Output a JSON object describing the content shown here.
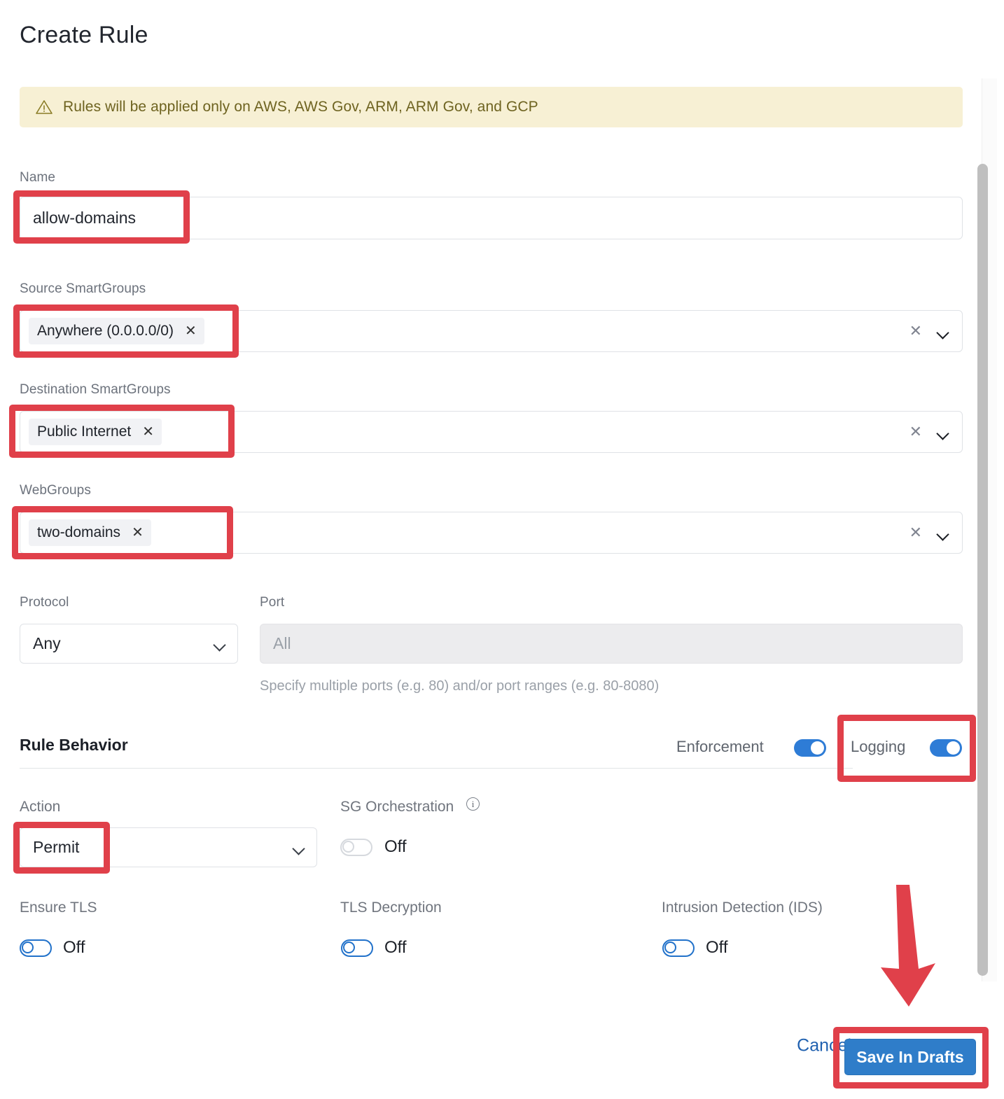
{
  "page": {
    "title": "Create Rule"
  },
  "banner": {
    "icon": "warning-triangle-icon",
    "text": "Rules will be applied only on AWS, AWS Gov, ARM, ARM Gov, and GCP"
  },
  "form": {
    "name": {
      "label": "Name",
      "value": "allow-domains",
      "placeholder": ""
    },
    "source_smartgroups": {
      "label": "Source SmartGroups",
      "chips": [
        "Anywhere (0.0.0.0/0)"
      ],
      "chip_remove": "✕",
      "clear": "✕"
    },
    "destination_smartgroups": {
      "label": "Destination SmartGroups",
      "chips": [
        "Public Internet"
      ],
      "chip_remove": "✕",
      "clear": "✕"
    },
    "webgroups": {
      "label": "WebGroups",
      "chips": [
        "two-domains"
      ],
      "chip_remove": "✕",
      "clear": "✕"
    },
    "protocol": {
      "label": "Protocol",
      "value": "Any"
    },
    "port": {
      "label": "Port",
      "placeholder": "All",
      "value": "",
      "helper": "Specify multiple ports (e.g. 80) and/or port ranges (e.g. 80-8080)"
    }
  },
  "rule_behavior": {
    "title": "Rule Behavior",
    "enforcement": {
      "label": "Enforcement",
      "state": "on"
    },
    "logging": {
      "label": "Logging",
      "state": "on"
    },
    "action": {
      "label": "Action",
      "value": "Permit"
    },
    "sg_orchestration": {
      "label": "SG Orchestration",
      "info_icon": "info-icon",
      "info_glyph": "i",
      "state_text": "Off"
    },
    "ensure_tls": {
      "label": "Ensure TLS",
      "state_text": "Off"
    },
    "tls_decryption": {
      "label": "TLS Decryption",
      "state_text": "Off"
    },
    "ids": {
      "label": "Intrusion Detection (IDS)",
      "state_text": "Off"
    }
  },
  "footer": {
    "cancel": "Cancel",
    "save": "Save In Drafts"
  },
  "colors": {
    "accent_blue": "#2f7dc9",
    "link_blue": "#2061b0",
    "annotation_red": "#e0404a",
    "banner_bg": "#f7f0d4",
    "banner_text": "#6e6320"
  }
}
